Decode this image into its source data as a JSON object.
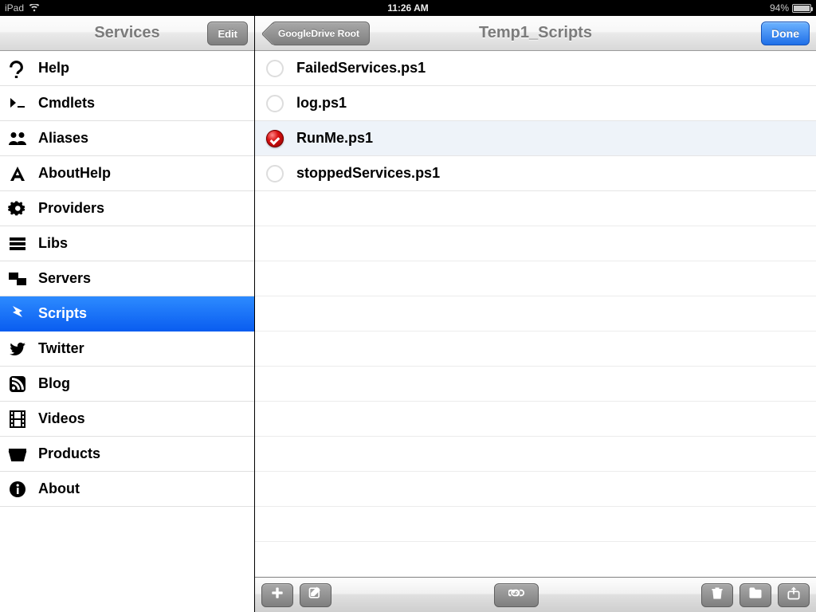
{
  "statusbar": {
    "device": "iPad",
    "time": "11:26 AM",
    "battery": "94%"
  },
  "sidebar": {
    "title": "Services",
    "edit_label": "Edit",
    "items": [
      {
        "label": "Help",
        "icon": "question"
      },
      {
        "label": "Cmdlets",
        "icon": "prompt"
      },
      {
        "label": "Aliases",
        "icon": "people"
      },
      {
        "label": "AboutHelp",
        "icon": "abouta"
      },
      {
        "label": "Providers",
        "icon": "gear"
      },
      {
        "label": "Libs",
        "icon": "books"
      },
      {
        "label": "Servers",
        "icon": "servers"
      },
      {
        "label": "Scripts",
        "icon": "scripts",
        "selected": true
      },
      {
        "label": "Twitter",
        "icon": "twitter"
      },
      {
        "label": "Blog",
        "icon": "rss"
      },
      {
        "label": "Videos",
        "icon": "film"
      },
      {
        "label": "Products",
        "icon": "products"
      },
      {
        "label": "About",
        "icon": "info"
      }
    ]
  },
  "main": {
    "back_label": "GoogleDrive Root",
    "title": "Temp1_Scripts",
    "done_label": "Done",
    "files": [
      {
        "name": "FailedServices.ps1",
        "selected": false
      },
      {
        "name": "log.ps1",
        "selected": false
      },
      {
        "name": "RunMe.ps1",
        "selected": true
      },
      {
        "name": "stoppedServices.ps1",
        "selected": false
      }
    ]
  },
  "toolbar": {
    "buttons_left": [
      "add",
      "compose"
    ],
    "buttons_center": [
      "link"
    ],
    "buttons_right": [
      "trash",
      "organize",
      "share"
    ]
  }
}
